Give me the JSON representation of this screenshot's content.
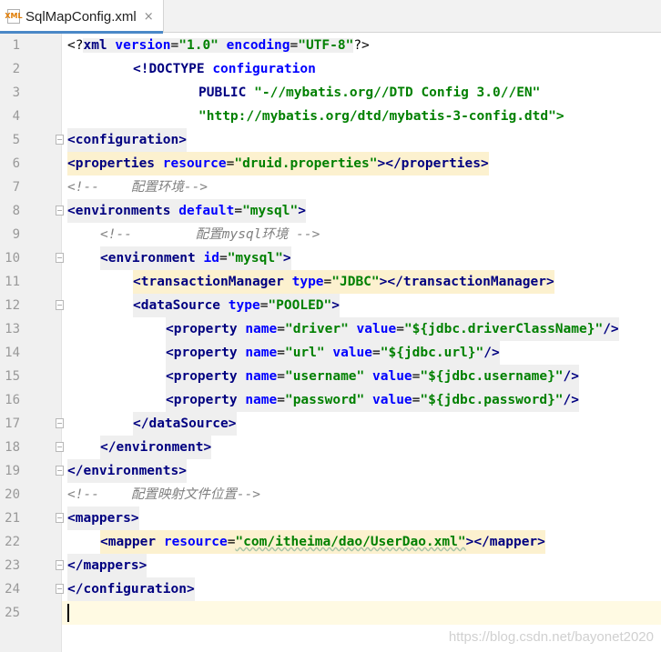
{
  "tab": {
    "icon_text": "XML",
    "label": "SqlMapConfig.xml",
    "close": "×"
  },
  "lines": {
    "n1": "1",
    "n2": "2",
    "n3": "3",
    "n4": "4",
    "n5": "5",
    "n6": "6",
    "n7": "7",
    "n8": "8",
    "n9": "9",
    "n10": "10",
    "n11": "11",
    "n12": "12",
    "n13": "13",
    "n14": "14",
    "n15": "15",
    "n16": "16",
    "n17": "17",
    "n18": "18",
    "n19": "19",
    "n20": "20",
    "n21": "21",
    "n22": "22",
    "n23": "23",
    "n24": "24",
    "n25": "25"
  },
  "code": {
    "l1_open": "<?",
    "l1_name": "xml",
    "l1_a1": "version",
    "l1_v1": "\"1.0\"",
    "l1_a2": "encoding",
    "l1_v2": "\"UTF-8\"",
    "l1_close": "?>",
    "l2_doctype": "<!DOCTYPE",
    "l2_root": "configuration",
    "l3_public": "PUBLIC",
    "l3_id": "\"-//mybatis.org//DTD Config 3.0//EN\"",
    "l4_dtd": "\"http://mybatis.org/dtd/mybatis-3-config.dtd\">",
    "l5": "<configuration>",
    "l6_open": "<properties",
    "l6_attr": "resource",
    "l6_val": "\"druid.properties\"",
    "l6_close": "></properties>",
    "l7": "<!--    配置环境-->",
    "l8_open": "<environments",
    "l8_attr": "default",
    "l8_val": "\"mysql\"",
    "l8_close": ">",
    "l9": "<!--        配置mysql环境 -->",
    "l10_open": "<environment",
    "l10_attr": "id",
    "l10_val": "\"mysql\"",
    "l10_close": ">",
    "l11_open": "<transactionManager",
    "l11_attr": "type",
    "l11_val": "\"JDBC\"",
    "l11_close": "></transactionManager>",
    "l12_open": "<dataSource",
    "l12_attr": "type",
    "l12_val": "\"POOLED\"",
    "l12_close": ">",
    "l13_open": "<property",
    "l13_a1": "name",
    "l13_v1": "\"driver\"",
    "l13_a2": "value",
    "l13_v2": "\"${jdbc.driverClassName}\"",
    "l13_close": "/>",
    "l14_open": "<property",
    "l14_a1": "name",
    "l14_v1": "\"url\"",
    "l14_a2": "value",
    "l14_v2": "\"${jdbc.url}\"",
    "l14_close": "/>",
    "l15_open": "<property",
    "l15_a1": "name",
    "l15_v1": "\"username\"",
    "l15_a2": "value",
    "l15_v2": "\"${jdbc.username}\"",
    "l15_close": "/>",
    "l16_open": "<property",
    "l16_a1": "name",
    "l16_v1": "\"password\"",
    "l16_a2": "value",
    "l16_v2": "\"${jdbc.password}\"",
    "l16_close": "/>",
    "l17": "</dataSource>",
    "l18": "</environment>",
    "l19": "</environments>",
    "l20": "<!--    配置映射文件位置-->",
    "l21": "<mappers>",
    "l22_open": "<mapper",
    "l22_attr": "resource",
    "l22_val": "\"com/itheima/dao/UserDao.xml\"",
    "l22_close": "></mapper>",
    "l23": "</mappers>",
    "l24": "</configuration>"
  },
  "watermark": "https://blog.csdn.net/bayonet2020",
  "colors": {
    "tag": "#000080",
    "attribute": "#0000ff",
    "value": "#008000",
    "comment": "#808080",
    "current_line": "#fffae3",
    "tag_highlight": "#efefef",
    "match_highlight": "#fcf1cf",
    "tab_accent": "#4a88c7"
  },
  "icons": {
    "tab": "xml-file-icon",
    "close": "close-icon",
    "fold": "fold-marker-icon"
  }
}
